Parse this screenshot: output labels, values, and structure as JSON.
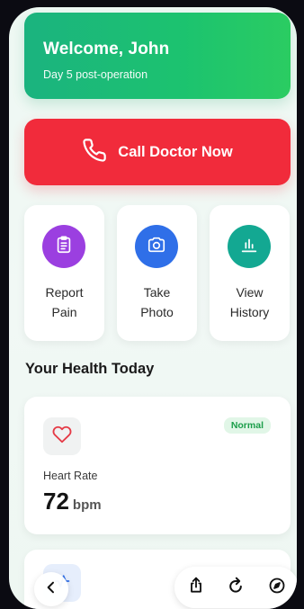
{
  "welcome": {
    "title": "Welcome, John",
    "subtitle": "Day 5 post-operation"
  },
  "call": {
    "label": "Call Doctor Now",
    "icon": "phone-icon",
    "color": "#f12b3b"
  },
  "actions": [
    {
      "label": "Report\nPain",
      "icon": "clipboard-icon",
      "color": "#9b3fe0"
    },
    {
      "label": "Take\nPhoto",
      "icon": "camera-icon",
      "color": "#2f6fe8"
    },
    {
      "label": "View\nHistory",
      "icon": "bar-chart-icon",
      "color": "#13a892"
    }
  ],
  "section": {
    "title": "Your Health Today"
  },
  "heart_rate": {
    "label": "Heart Rate",
    "value": "72",
    "unit": "bpm",
    "status": "Normal",
    "icon": "heart-icon"
  },
  "next_metric": {
    "icon": "activity-icon"
  },
  "browser_nav": {
    "back_icon": "chevron-left-icon",
    "share_icon": "share-icon",
    "reload_icon": "reload-icon",
    "compass_icon": "compass-icon"
  },
  "colors": {
    "welcome_gradient_start": "#1bb37f",
    "welcome_gradient_end": "#2bcc62",
    "status_normal": "#1b9e4a"
  }
}
